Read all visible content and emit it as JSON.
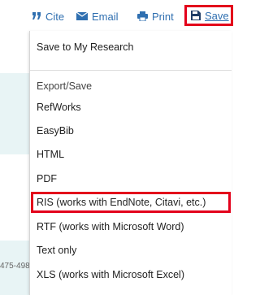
{
  "toolbar": {
    "cite_label": "Cite",
    "email_label": "Email",
    "print_label": "Print",
    "save_label": "Save"
  },
  "side_text": "475-498",
  "menu": {
    "save_to_research": "Save to My Research",
    "export_header": "Export/Save",
    "items": [
      "RefWorks",
      "EasyBib",
      "HTML",
      "PDF",
      "RIS (works with EndNote, Citavi, etc.)",
      "RTF (works with Microsoft Word)",
      "Text only",
      "XLS (works with Microsoft Excel)"
    ]
  },
  "colors": {
    "link": "#2f6fb0",
    "highlight": "#e3001b",
    "panel_bg": "#e8f4f5"
  },
  "icons": [
    "quote-icon",
    "envelope-icon",
    "printer-icon",
    "floppy-disk-icon"
  ]
}
